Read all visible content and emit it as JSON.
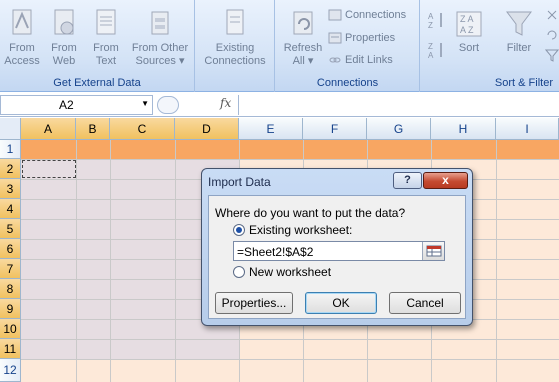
{
  "ribbon": {
    "get_external_data": {
      "label": "Get External Data",
      "buttons": [
        {
          "line1": "From",
          "line2": "Access",
          "icon": "access-icon"
        },
        {
          "line1": "From",
          "line2": "Web",
          "icon": "web-icon"
        },
        {
          "line1": "From",
          "line2": "Text",
          "icon": "text-file-icon"
        },
        {
          "line1": "From Other",
          "line2": "Sources",
          "icon": "other-sources-icon"
        },
        {
          "line1": "Existing",
          "line2": "Connections",
          "icon": "existing-connections-icon"
        }
      ]
    },
    "connections": {
      "label": "Connections",
      "refresh_line1": "Refresh",
      "refresh_line2": "All",
      "items": [
        "Connections",
        "Properties",
        "Edit Links"
      ]
    },
    "sort_filter": {
      "label": "Sort & Filter",
      "sort": "Sort",
      "filter": "Filter"
    }
  },
  "formula_bar": {
    "name_box": "A2",
    "fx": "fx",
    "formula": ""
  },
  "sheet": {
    "columns": [
      "A",
      "B",
      "C",
      "D",
      "E",
      "F",
      "G",
      "H",
      "I"
    ],
    "rows": [
      "1",
      "2",
      "3",
      "4",
      "5",
      "6",
      "7",
      "8",
      "9",
      "10",
      "11",
      "12"
    ],
    "selected_cell": "A2"
  },
  "dialog": {
    "title": "Import Data",
    "help": "?",
    "close": "x",
    "question": "Where do you want to put the data?",
    "existing_worksheet": "Existing worksheet:",
    "reference": "=Sheet2!$A$2",
    "new_worksheet": "New worksheet",
    "properties": "Properties...",
    "ok": "OK",
    "cancel": "Cancel",
    "selected_option": "existing"
  },
  "colors": {
    "header_row": "#f79646",
    "table_band": "#e6dde2",
    "sheet_fill": "#fde9d9",
    "close_button": "#c44a31"
  }
}
